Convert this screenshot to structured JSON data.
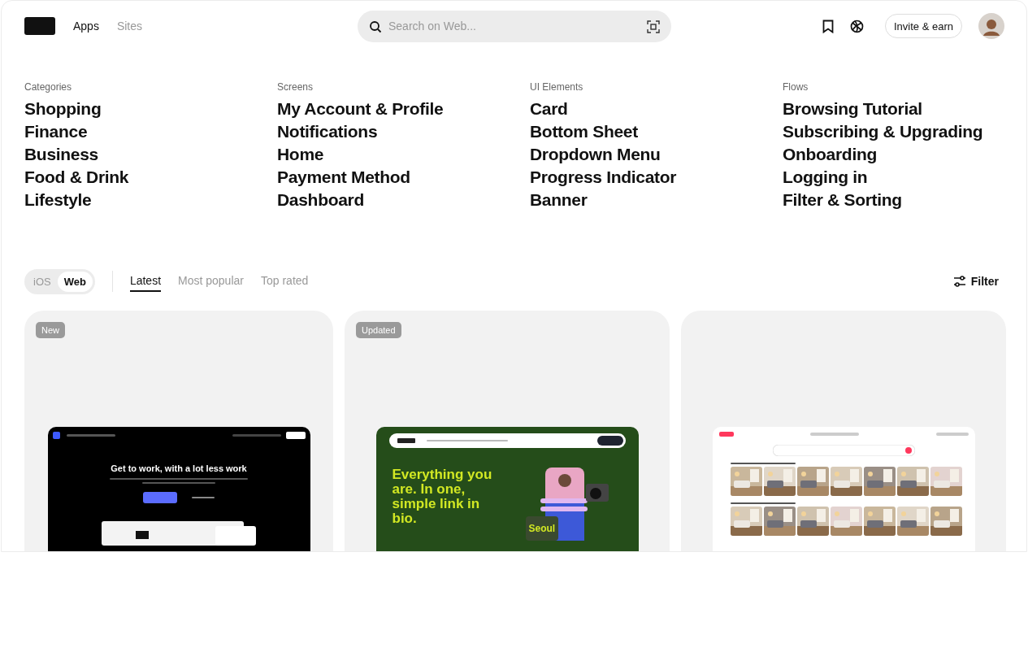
{
  "nav": [
    {
      "label": "Apps",
      "selected": true
    },
    {
      "label": "Sites",
      "selected": false
    }
  ],
  "search": {
    "placeholder": "Search on Web..."
  },
  "invite": "Invite & earn",
  "directory": [
    {
      "heading": "Categories",
      "items": [
        "Shopping",
        "Finance",
        "Business",
        "Food & Drink",
        "Lifestyle"
      ]
    },
    {
      "heading": "Screens",
      "items": [
        "My Account & Profile",
        "Notifications",
        "Home",
        "Payment Method",
        "Dashboard"
      ]
    },
    {
      "heading": "UI Elements",
      "items": [
        "Card",
        "Bottom Sheet",
        "Dropdown Menu",
        "Progress Indicator",
        "Banner"
      ]
    },
    {
      "heading": "Flows",
      "items": [
        "Browsing Tutorial",
        "Subscribing & Upgrading",
        "Onboarding",
        "Logging in",
        "Filter & Sorting"
      ]
    }
  ],
  "platform": [
    {
      "label": "iOS",
      "selected": false
    },
    {
      "label": "Web",
      "selected": true
    }
  ],
  "sort_tabs": [
    {
      "label": "Latest",
      "selected": true
    },
    {
      "label": "Most popular",
      "selected": false
    },
    {
      "label": "Top rated",
      "selected": false
    }
  ],
  "filter": "Filter",
  "cards": [
    {
      "badge": "New",
      "preview": {
        "kind": "dropbox",
        "headline": "Get to work, with a lot less work"
      }
    },
    {
      "badge": "Updated",
      "preview": {
        "kind": "linktree",
        "headline": "Everything you are. In one, simple link in bio.",
        "tag": "Seoul"
      }
    },
    {
      "preview": {
        "kind": "airbnb"
      }
    }
  ]
}
